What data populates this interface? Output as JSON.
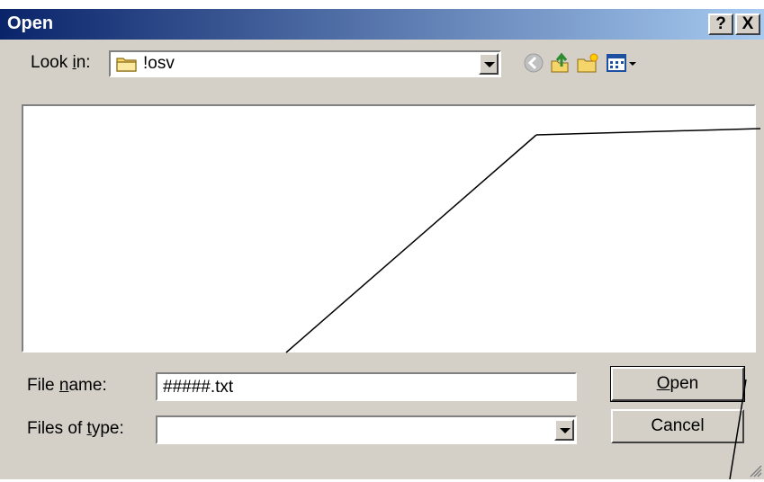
{
  "window": {
    "title": "Open",
    "help_label": "?",
    "close_label": "X"
  },
  "look_in": {
    "label": "Look in:",
    "mnemonic": "i",
    "value": "!osv"
  },
  "toolbar": {
    "icons": [
      "back-arrow-icon",
      "up-folder-icon",
      "new-folder-icon",
      "view-menu-icon"
    ]
  },
  "file_name": {
    "label": "File name:",
    "mnemonic": "n",
    "value": "#####.txt"
  },
  "file_type": {
    "label": "Files of type:",
    "mnemonic": "t",
    "value": ""
  },
  "buttons": {
    "open": "Open",
    "open_mnemonic": "O",
    "cancel": "Cancel"
  },
  "colors": {
    "title_start": "#0a246a",
    "title_end": "#a6caf0",
    "face": "#d4d0c8"
  }
}
